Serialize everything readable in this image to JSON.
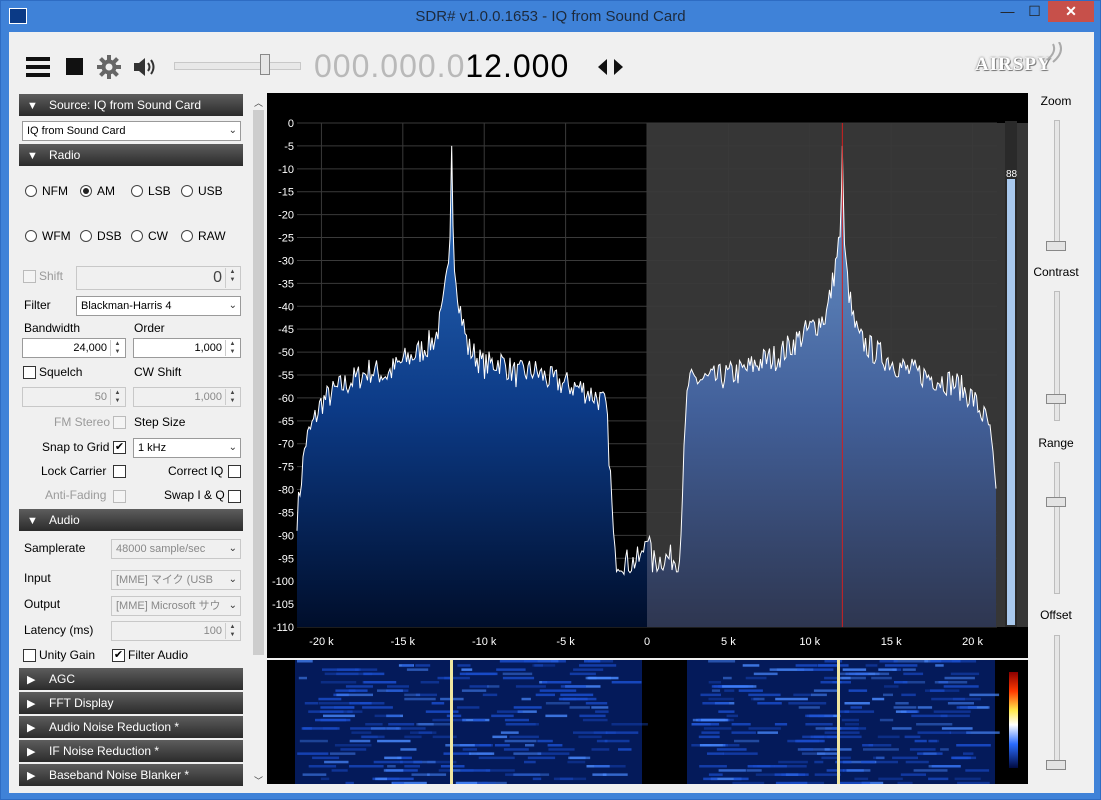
{
  "window": {
    "title": "SDR# v1.0.0.1653 - IQ from Sound Card",
    "minimize": "—",
    "maximize": "☐",
    "close": "✕"
  },
  "toolbar": {
    "freq_dim": "000.000.0",
    "freq_hi": "12.",
    "freq_cursor": "0",
    "freq_tail": "00",
    "logo": "AIRSPY"
  },
  "source": {
    "header": "Source: IQ from Sound Card",
    "selected": "IQ from Sound Card"
  },
  "radio": {
    "header": "Radio",
    "modes": [
      "NFM",
      "AM",
      "LSB",
      "USB",
      "WFM",
      "DSB",
      "CW",
      "RAW"
    ],
    "selected_mode": "AM",
    "shift_label": "Shift",
    "shift_value": "0",
    "filter_label": "Filter",
    "filter_value": "Blackman-Harris 4",
    "bandwidth_label": "Bandwidth",
    "bandwidth_value": "24,000",
    "order_label": "Order",
    "order_value": "1,000",
    "squelch_label": "Squelch",
    "squelch_value": "50",
    "cw_shift_label": "CW Shift",
    "cw_shift_value": "1,000",
    "fm_stereo_label": "FM Stereo",
    "step_size_label": "Step Size",
    "snap_label": "Snap to Grid",
    "snap_value": "1 kHz",
    "lock_carrier_label": "Lock Carrier",
    "correct_iq_label": "Correct IQ",
    "anti_fading_label": "Anti-Fading",
    "swap_iq_label": "Swap I & Q"
  },
  "audio": {
    "header": "Audio",
    "samplerate_label": "Samplerate",
    "samplerate_value": "48000 sample/sec",
    "input_label": "Input",
    "input_value": "[MME] マイク (USB A",
    "output_label": "Output",
    "output_value": "[MME] Microsoft サウ",
    "latency_label": "Latency (ms)",
    "latency_value": "100",
    "unity_gain_label": "Unity Gain",
    "filter_audio_label": "Filter Audio"
  },
  "collapsed_sections": [
    "AGC",
    "FFT Display",
    "Audio Noise Reduction *",
    "IF Noise Reduction *",
    "Baseband Noise Blanker *"
  ],
  "right_panel": {
    "zoom": "Zoom",
    "contrast": "Contrast",
    "range": "Range",
    "offset": "Offset"
  },
  "chart_data": {
    "type": "area",
    "title": "",
    "xlabel": "",
    "ylabel": "",
    "x_ticks": [
      "-20 k",
      "-15 k",
      "-10 k",
      "-5 k",
      "0",
      "5 k",
      "10 k",
      "15 k",
      "20 k"
    ],
    "y_ticks": [
      "0",
      "-5",
      "-10",
      "-15",
      "-20",
      "-25",
      "-30",
      "-35",
      "-40",
      "-45",
      "-50",
      "-55",
      "-60",
      "-65",
      "-70",
      "-75",
      "-80",
      "-85",
      "-90",
      "-95",
      "-100",
      "-105",
      "-110"
    ],
    "xlim": [
      -21000,
      21000
    ],
    "ylim": [
      -110,
      0
    ],
    "tuned_frequency_hz": 12000,
    "filter_range_hz": [
      0,
      24000
    ],
    "level_meter_value": "88",
    "series": [
      {
        "x": [
          -21500,
          -21000,
          -20000,
          -19000,
          -18000,
          -17000,
          -16000,
          -15000,
          -14000,
          -13000,
          -12600,
          -12300,
          -12100,
          -12000,
          -11900,
          -11700,
          -11400,
          -11000,
          -10000,
          -9000,
          -8000,
          -7000,
          -6000,
          -5000,
          -4000,
          -3000,
          -2500,
          -2200,
          -2000,
          -1000,
          -300,
          0,
          300,
          1000,
          2000,
          2200,
          2500,
          3000,
          4000,
          5000,
          6000,
          7000,
          8000,
          9000,
          10000,
          11000,
          11400,
          11700,
          11900,
          12000,
          12100,
          12300,
          12600,
          13000,
          14000,
          15000,
          16000,
          17000,
          18000,
          19000,
          20000,
          20500,
          21000,
          21300,
          21500
        ],
        "y": [
          -86,
          -70,
          -61,
          -58,
          -56,
          -54,
          -55,
          -52,
          -50,
          -47,
          -42,
          -34,
          -25,
          -5,
          -26,
          -35,
          -42,
          -49,
          -53,
          -52,
          -55,
          -54,
          -56,
          -57,
          -58,
          -60,
          -62,
          -80,
          -95,
          -96,
          -95,
          -88,
          -96,
          -95,
          -95,
          -78,
          -57,
          -56,
          -56,
          -55,
          -54,
          -52,
          -51,
          -48,
          -45,
          -42,
          -35,
          -28,
          -24,
          -5,
          -25,
          -34,
          -42,
          -47,
          -50,
          -52,
          -54,
          -55,
          -56,
          -57,
          -60,
          -63,
          -66,
          -75,
          -86
        ]
      }
    ]
  }
}
